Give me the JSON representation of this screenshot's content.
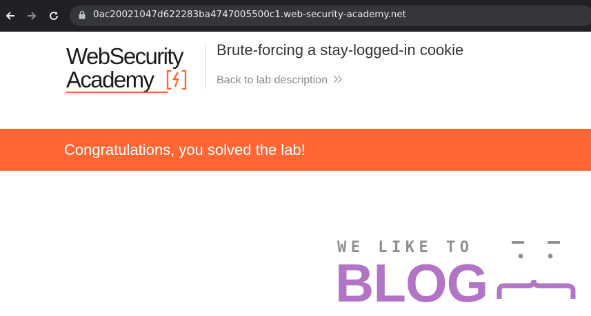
{
  "browser": {
    "url": "0ac20021047d622283ba4747005500c1.web-security-academy.net",
    "icons": [
      "back-arrow-icon",
      "forward-arrow-icon",
      "reload-icon",
      "lock-icon"
    ]
  },
  "header": {
    "logo_line1": "WebSecurity",
    "logo_line2": "Academy",
    "lab_title": "Brute-forcing a stay-logged-in cookie",
    "back_link": "Back to lab description"
  },
  "banner": {
    "text": "Congratulations, you solved the lab!"
  },
  "hero": {
    "tagline": "WE LIKE TO",
    "title": "BLOG"
  },
  "colors": {
    "accent": "#ff6633",
    "blog_purple": "#b274c4",
    "chrome_dark": "#202124"
  }
}
